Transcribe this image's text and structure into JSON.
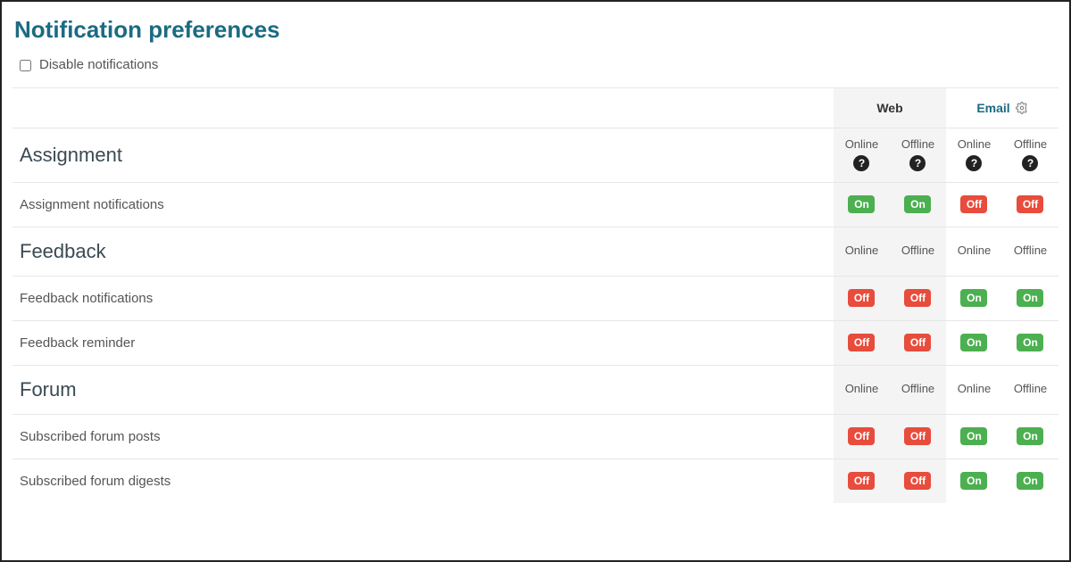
{
  "title": "Notification preferences",
  "disable_label": "Disable notifications",
  "columns_group": {
    "web": "Web",
    "email": "Email"
  },
  "sub_columns": {
    "online": "Online",
    "offline": "Offline"
  },
  "toggle": {
    "on": "On",
    "off": "Off"
  },
  "sections": [
    {
      "name": "Assignment",
      "show_help": true,
      "rows": [
        {
          "label": "Assignment notifications",
          "web_online": "on",
          "web_offline": "on",
          "email_online": "off",
          "email_offline": "off"
        }
      ]
    },
    {
      "name": "Feedback",
      "show_help": false,
      "rows": [
        {
          "label": "Feedback notifications",
          "web_online": "off",
          "web_offline": "off",
          "email_online": "on",
          "email_offline": "on"
        },
        {
          "label": "Feedback reminder",
          "web_online": "off",
          "web_offline": "off",
          "email_online": "on",
          "email_offline": "on"
        }
      ]
    },
    {
      "name": "Forum",
      "show_help": false,
      "rows": [
        {
          "label": "Subscribed forum posts",
          "web_online": "off",
          "web_offline": "off",
          "email_online": "on",
          "email_offline": "on"
        },
        {
          "label": "Subscribed forum digests",
          "web_online": "off",
          "web_offline": "off",
          "email_online": "on",
          "email_offline": "on"
        }
      ]
    }
  ]
}
